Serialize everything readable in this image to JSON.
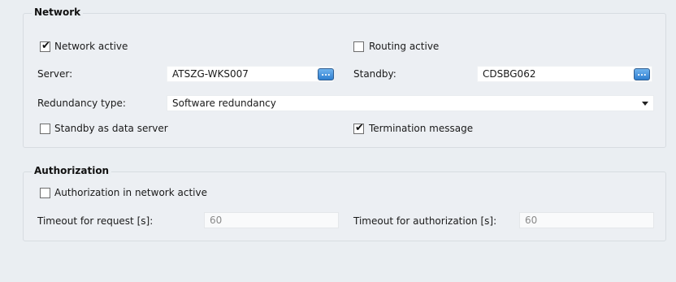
{
  "network": {
    "title": "Network",
    "network_active": {
      "label": "Network active",
      "checked": true
    },
    "routing_active": {
      "label": "Routing active",
      "checked": false
    },
    "server": {
      "label": "Server:",
      "value": "ATSZG-WKS007"
    },
    "standby": {
      "label": "Standby:",
      "value": "CDSBG062"
    },
    "browse_glyph": "...",
    "redundancy": {
      "label": "Redundancy type:",
      "value": "Software redundancy"
    },
    "standby_data_server": {
      "label": "Standby as data server",
      "checked": false
    },
    "termination_message": {
      "label": "Termination message",
      "checked": true
    }
  },
  "authorization": {
    "title": "Authorization",
    "auth_in_network": {
      "label": "Authorization in network active",
      "checked": false
    },
    "timeout_request": {
      "label": "Timeout for request [s]:",
      "value": "60"
    },
    "timeout_authorization": {
      "label": "Timeout for authorization [s]:",
      "value": "60"
    }
  },
  "icons": {
    "browse": "browse-dots-icon",
    "dropdown": "chevron-down-icon",
    "check": "checkmark-icon"
  }
}
